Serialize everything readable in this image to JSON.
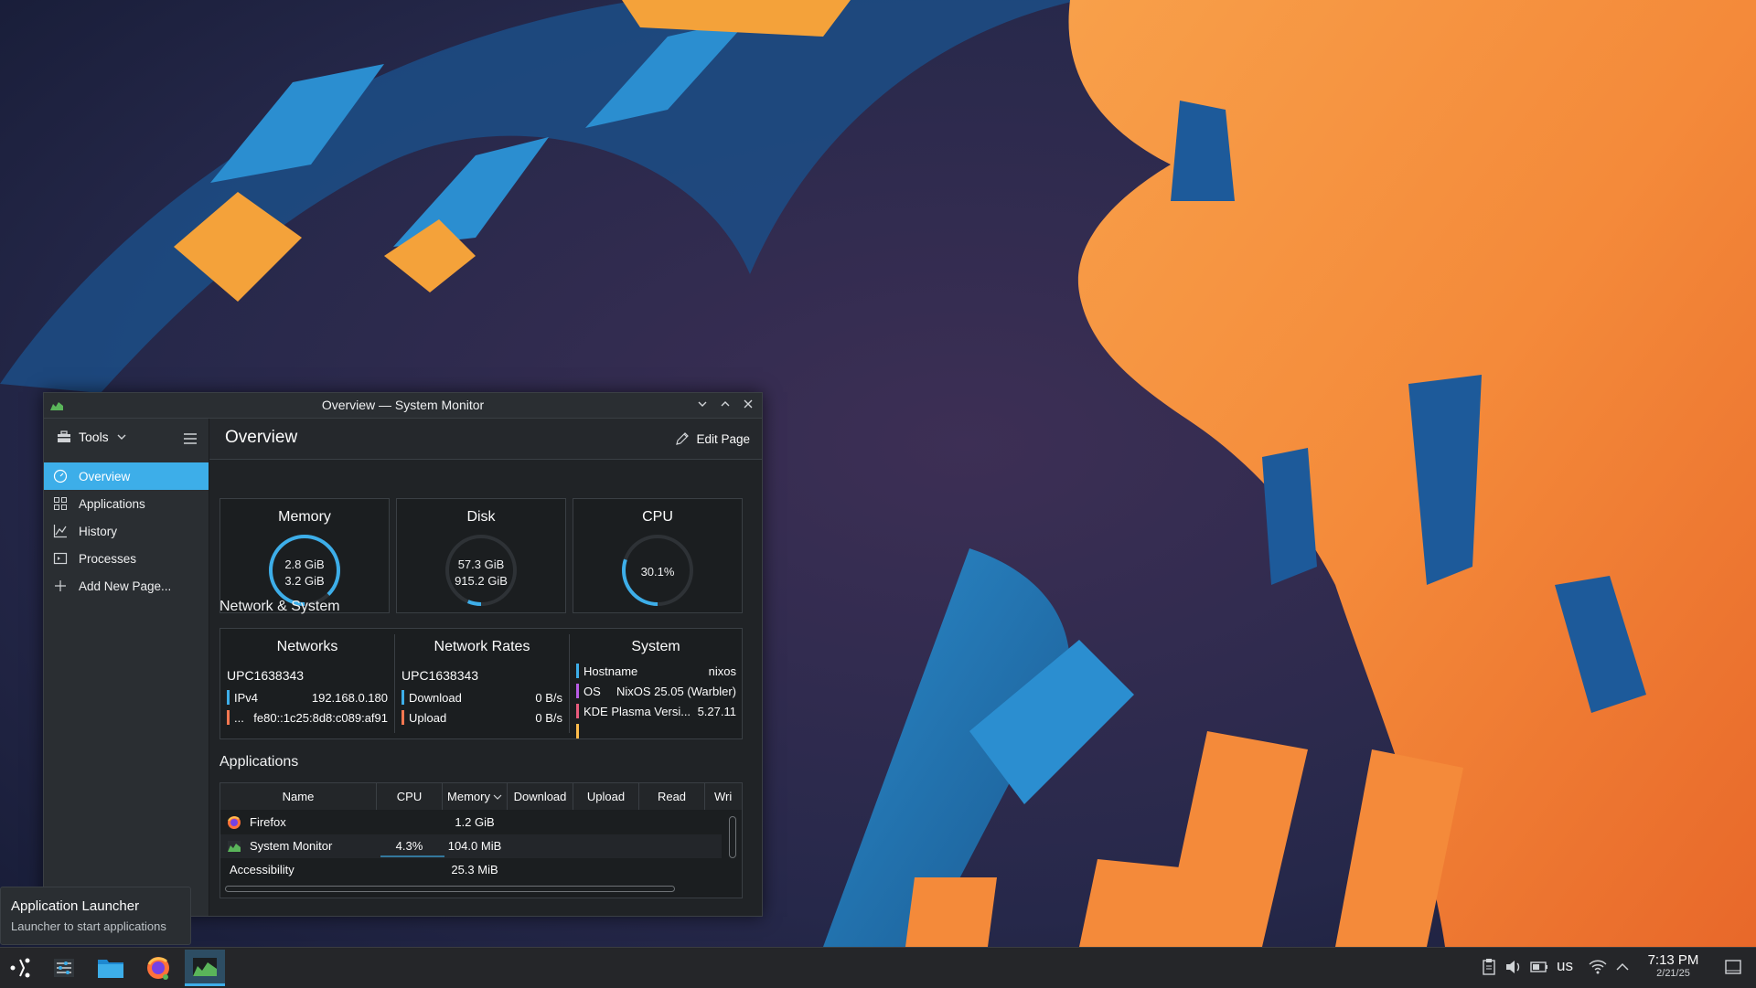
{
  "window": {
    "title": "Overview — System Monitor"
  },
  "sidebar": {
    "tools_label": "Tools",
    "items": [
      {
        "label": "Overview",
        "icon": "overview-icon",
        "active": true
      },
      {
        "label": "Applications",
        "icon": "applications-grid-icon"
      },
      {
        "label": "History",
        "icon": "history-chart-icon"
      },
      {
        "label": "Processes",
        "icon": "processes-icon"
      },
      {
        "label": "Add New Page...",
        "icon": "plus-icon"
      }
    ]
  },
  "header": {
    "title": "Overview",
    "edit_label": "Edit Page"
  },
  "cards": {
    "memory": {
      "title": "Memory",
      "used": "2.8 GiB",
      "total": "3.2 GiB",
      "fraction": 0.875
    },
    "disk": {
      "title": "Disk",
      "used": "57.3 GiB",
      "total": "915.2 GiB",
      "fraction": 0.063
    },
    "cpu": {
      "title": "CPU",
      "value": "30.1%",
      "fraction": 0.301
    }
  },
  "network_system": {
    "section_title": "Network & System",
    "networks": {
      "title": "Networks",
      "interface": "UPC1638343",
      "rows": [
        {
          "label": "IPv4",
          "value": "192.168.0.180",
          "color": "#3daee9"
        },
        {
          "label": "...",
          "value": "fe80::1c25:8d8:c089:af91",
          "color": "#f47750"
        }
      ]
    },
    "rates": {
      "title": "Network Rates",
      "interface": "UPC1638343",
      "rows": [
        {
          "label": "Download",
          "value": "0 B/s",
          "color": "#3daee9"
        },
        {
          "label": "Upload",
          "value": "0 B/s",
          "color": "#f47750"
        }
      ]
    },
    "system": {
      "title": "System",
      "rows": [
        {
          "label": "Hostname",
          "value": "nixos",
          "color": "#3daee9"
        },
        {
          "label": "OS",
          "value": "NixOS 25.05 (Warbler)",
          "color": "#b95ce6"
        },
        {
          "label": "KDE Plasma Versi...",
          "value": "5.27.11",
          "color": "#e95b7c"
        },
        {
          "label": "",
          "value": "",
          "color": "#fdbc4b"
        }
      ]
    }
  },
  "applications": {
    "section_title": "Applications",
    "columns": [
      "Name",
      "CPU",
      "Memory",
      "Download",
      "Upload",
      "Read",
      "Wri"
    ],
    "rows": [
      {
        "name": "Firefox",
        "cpu": "",
        "memory": "1.2 GiB",
        "icon": "firefox-icon"
      },
      {
        "name": "System Monitor",
        "cpu": "4.3%",
        "memory": "104.0 MiB",
        "icon": "system-monitor-icon"
      },
      {
        "name": "Accessibility",
        "cpu": "",
        "memory": "25.3 MiB",
        "icon": ""
      }
    ]
  },
  "tooltip": {
    "title": "Application Launcher",
    "subtitle": "Launcher to start applications"
  },
  "taskbar": {
    "apps": [
      "app-launcher-icon",
      "system-settings-icon",
      "file-manager-icon",
      "firefox-icon",
      "system-monitor-icon"
    ],
    "keyboard_layout": "us",
    "time": "7:13 PM",
    "date": "2/21/25"
  },
  "colors": {
    "accent": "#3daee9",
    "window_bg": "#202326",
    "wallpaper_orange": "#f4913a",
    "wallpaper_blue": "#1f78b8"
  }
}
